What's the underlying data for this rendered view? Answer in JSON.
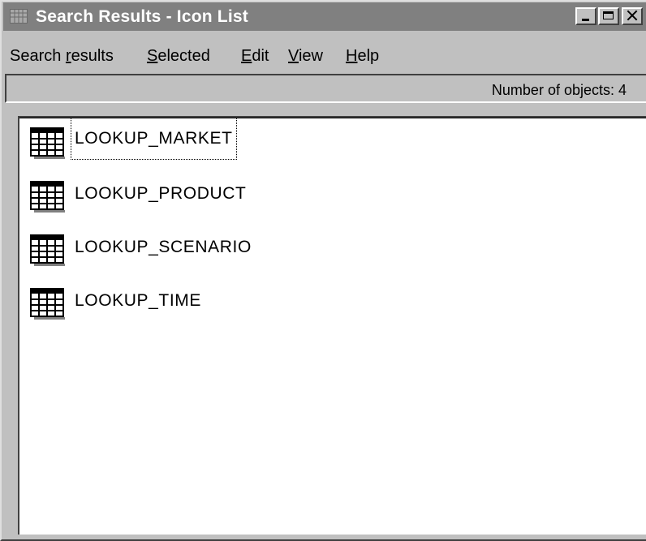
{
  "window": {
    "title": "Search Results - Icon List"
  },
  "menu": {
    "items": [
      {
        "pre": "Search ",
        "key": "r",
        "post": "esults"
      },
      {
        "pre": "",
        "key": "S",
        "post": "elected"
      },
      {
        "pre": "",
        "key": "E",
        "post": "dit"
      },
      {
        "pre": "",
        "key": "V",
        "post": "iew"
      },
      {
        "pre": "",
        "key": "H",
        "post": "elp"
      }
    ]
  },
  "status": {
    "text": "Number of objects: 4"
  },
  "results": {
    "items": [
      {
        "label": "LOOKUP_MARKET",
        "icon": "table-icon",
        "focused": true
      },
      {
        "label": "LOOKUP_PRODUCT",
        "icon": "table-icon",
        "focused": false
      },
      {
        "label": "LOOKUP_SCENARIO",
        "icon": "table-icon",
        "focused": false
      },
      {
        "label": "LOOKUP_TIME",
        "icon": "table-icon",
        "focused": false
      }
    ]
  },
  "colors": {
    "titlebar": "#808080",
    "chrome": "#c0c0c0",
    "content_bg": "#ffffff"
  }
}
